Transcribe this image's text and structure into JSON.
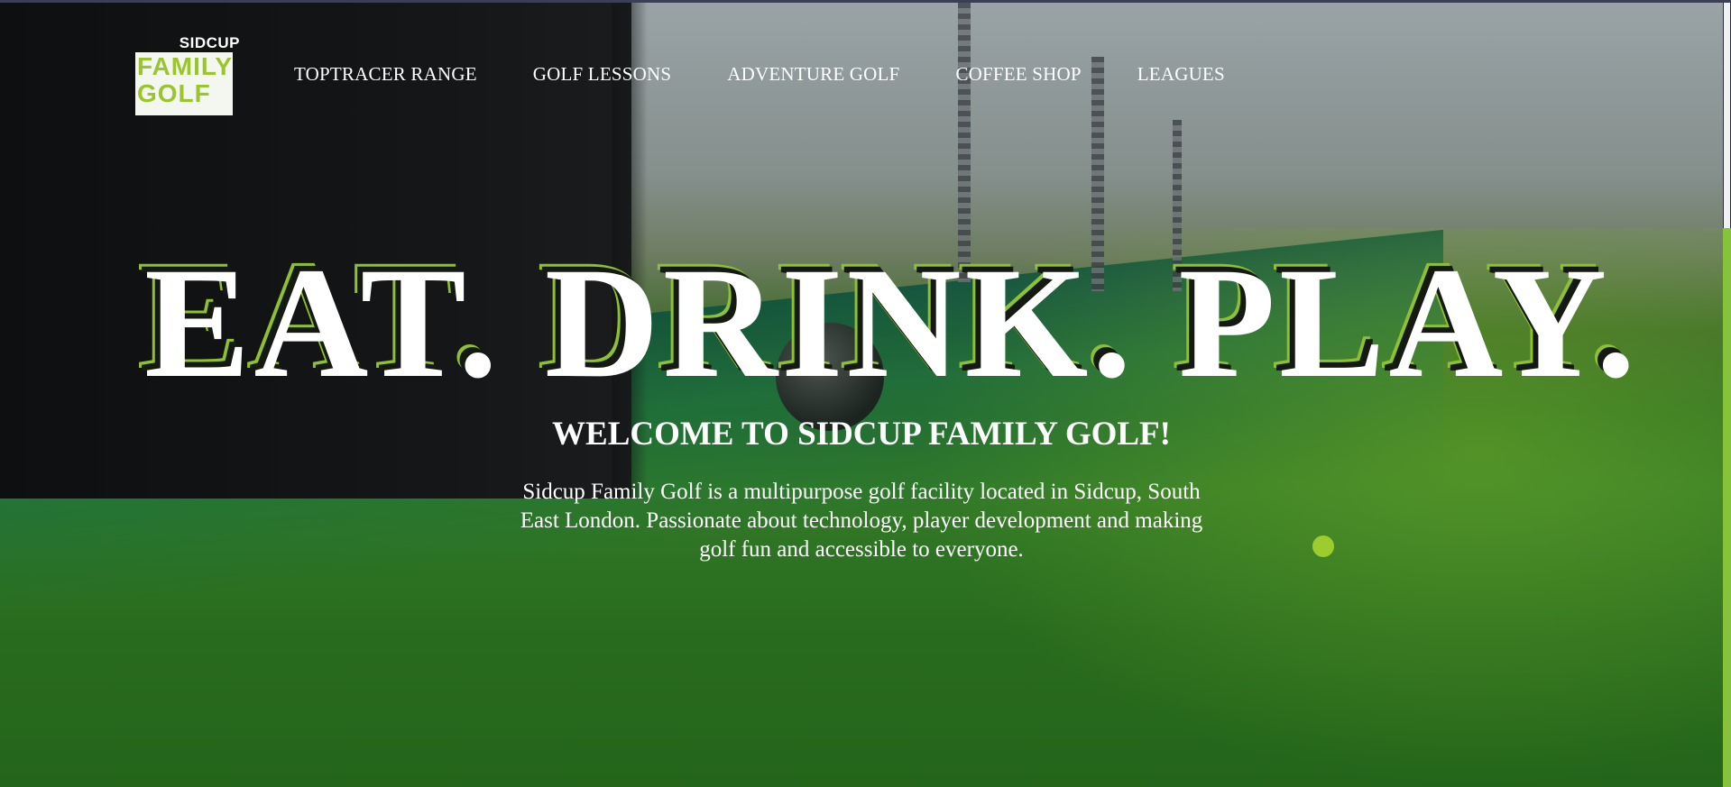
{
  "brand": {
    "logo_top": "SIDCUP",
    "logo_line1": "FAMILY",
    "logo_line2": "GOLF",
    "accent_color": "#9ccc2e"
  },
  "nav": {
    "items": [
      {
        "label": "TOPTRACER RANGE"
      },
      {
        "label": "GOLF LESSONS"
      },
      {
        "label": "ADVENTURE GOLF"
      },
      {
        "label": "COFFEE SHOP"
      },
      {
        "label": "LEAGUES"
      }
    ]
  },
  "hero": {
    "headline": "EAT. DRINK. PLAY.",
    "welcome": "WELCOME TO SIDCUP FAMILY GOLF!",
    "description": "Sidcup Family Golf is a multipurpose golf facility located in Sidcup, South East London. Passionate about technology, player development and making golf fun and accessible to everyone."
  }
}
